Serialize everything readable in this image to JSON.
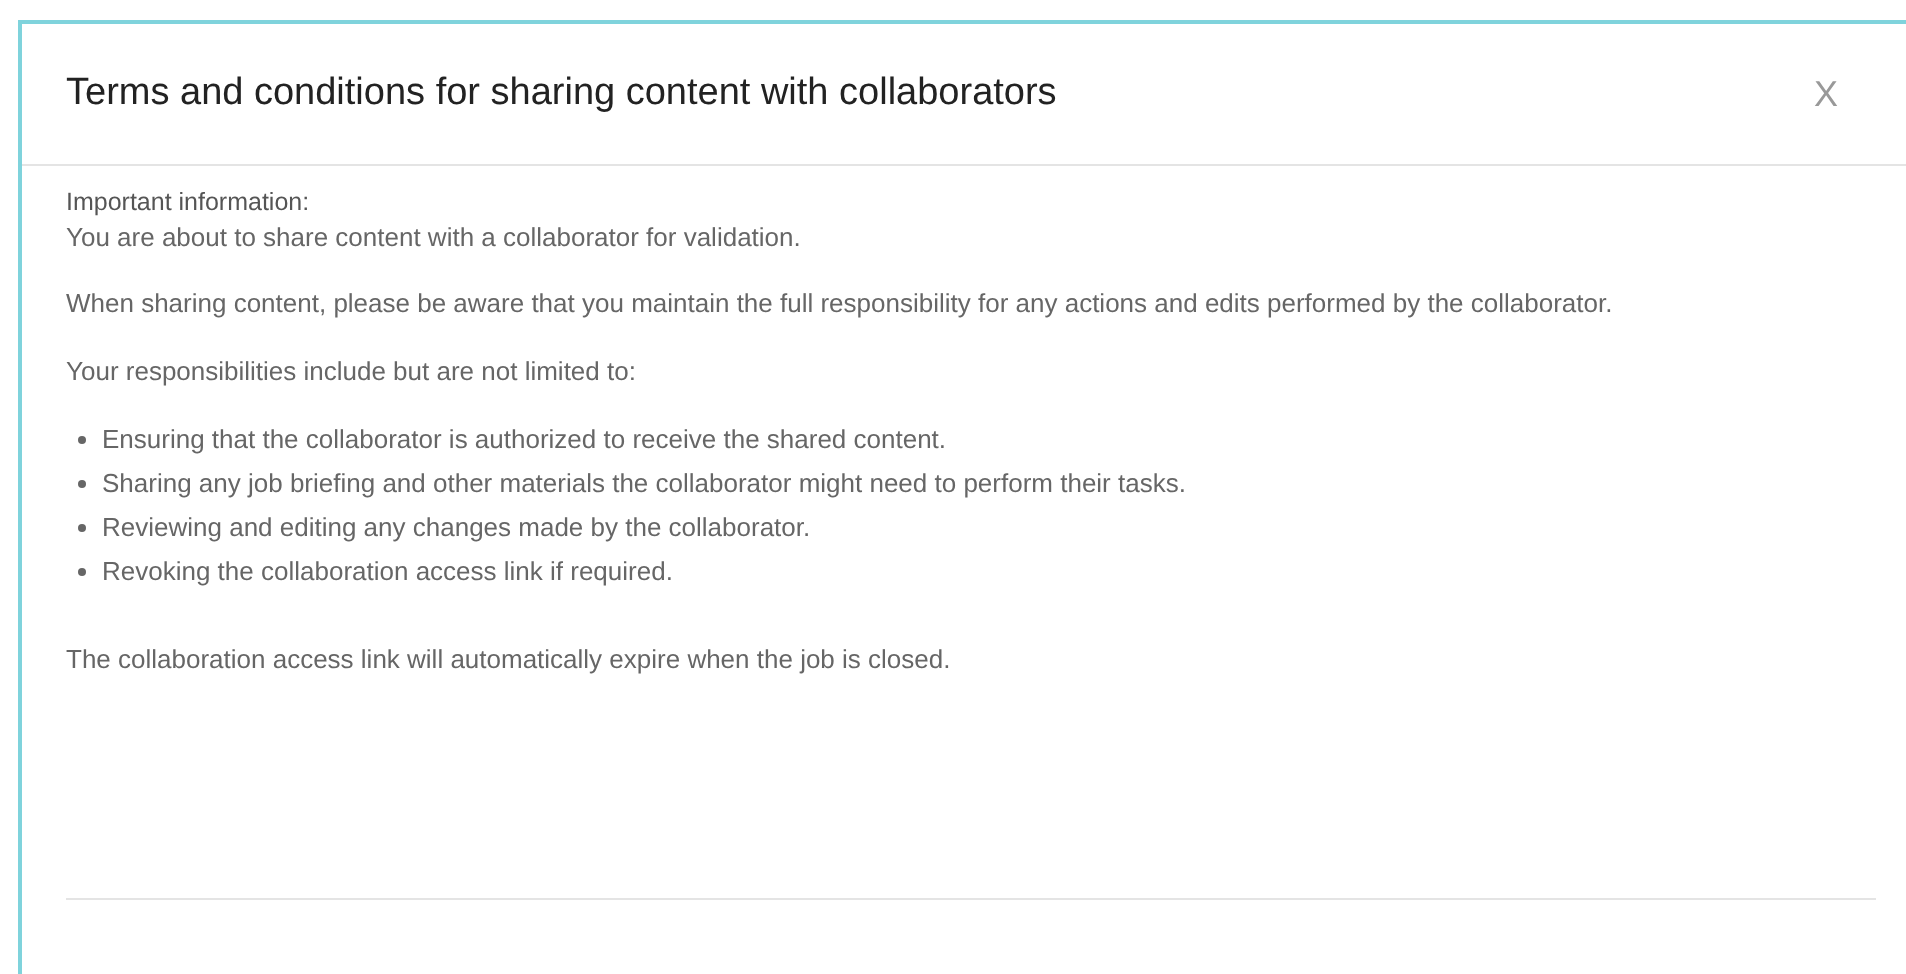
{
  "dialog": {
    "title": "Terms and conditions for sharing content with collaborators",
    "close": "X",
    "heading": "Important information:",
    "intro": "You are about to share content with a collaborator for validation.",
    "paragraphs": [
      "When sharing content, please be aware that you maintain the full responsibility for any actions and edits performed by the collaborator.",
      "Your responsibilities include but are not limited to:"
    ],
    "responsibilities": [
      "Ensuring that the collaborator is authorized to receive the shared content.",
      "Sharing any job briefing and other materials the collaborator might need to perform their tasks.",
      "Reviewing and editing any changes made by the collaborator.",
      "Revoking the collaboration access link if required."
    ],
    "footer_note": "The collaboration access link will automatically expire when the job is closed."
  }
}
